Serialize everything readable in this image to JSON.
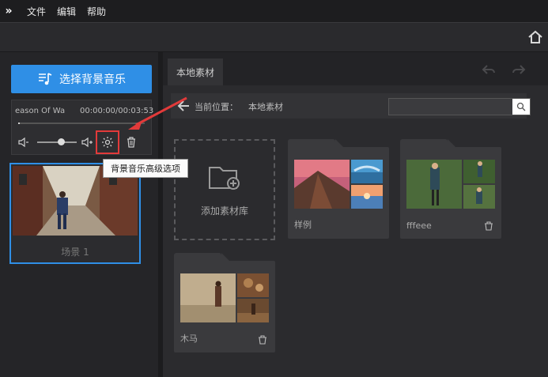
{
  "menu": {
    "logo": "»",
    "items": [
      {
        "label": "文件"
      },
      {
        "label": "编辑"
      },
      {
        "label": "帮助"
      }
    ]
  },
  "left": {
    "select_music_label": "选择背景音乐",
    "music_name": "eason Of Wa",
    "music_time": "00:00:00/00:03:53",
    "volume_level": 0.6,
    "advanced_tooltip": "背景音乐高级选项",
    "scene_label": "场景 1"
  },
  "right": {
    "tab_local": "本地素材",
    "path_label": "当前位置：",
    "path_value": "本地素材",
    "search_placeholder": "",
    "add_library_label": "添加素材库",
    "folders": [
      {
        "name": "样例"
      },
      {
        "name": "fffeee"
      },
      {
        "name": "木马"
      }
    ]
  },
  "colors": {
    "accent": "#2f8fe6",
    "highlight": "#e23a3a"
  }
}
